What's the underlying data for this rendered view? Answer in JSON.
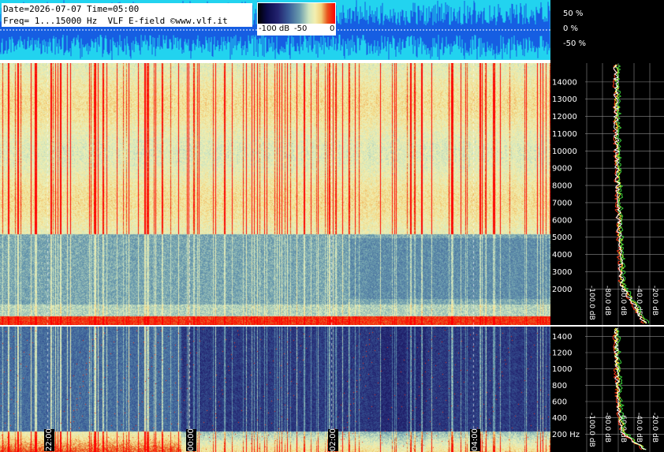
{
  "header": {
    "line1": "Date=2026-07-07 Time=05:00",
    "line2": "Freq= 1...15000 Hz  VLF E-field ©www.vlf.it"
  },
  "colorbar": {
    "labels": [
      "-100 dB",
      "-50",
      "0"
    ],
    "colors": [
      "#000000",
      "#23236f",
      "#3a5d98",
      "#6a9cae",
      "#f3efb0",
      "#e8541c",
      "#ff0000"
    ]
  },
  "waveform": {
    "labels": [
      "50 %",
      "0 %",
      "-50 %"
    ],
    "background": "#22d3ef",
    "trace_color": "#1010d8"
  },
  "chart_data": [
    {
      "type": "heatmap",
      "title": "",
      "panel": "spectrogram-upper",
      "ylim": [
        0,
        15000
      ],
      "yticks": [
        2000,
        3000,
        4000,
        5000,
        6000,
        7000,
        8000,
        9000,
        10000,
        11000,
        12000,
        13000,
        14000
      ],
      "ytick_labels": [
        "2000",
        "3000",
        "4000",
        "5000",
        "6000",
        "7000",
        "8000",
        "9000",
        "10000",
        "11000",
        "12000",
        "13000",
        "14000"
      ],
      "side_spectrum_xlabels": [
        "-100.0 dB",
        "-80.0 dB",
        "-60.0 dB",
        "-40.0 dB",
        "-20.0 dB"
      ]
    },
    {
      "type": "heatmap",
      "title": "",
      "panel": "spectrogram-lower",
      "ylim": [
        0,
        1500
      ],
      "yticks": [
        200,
        400,
        600,
        800,
        1000,
        1200,
        1400
      ],
      "ytick_labels": [
        "200 Hz",
        "400",
        "600",
        "800",
        "1000",
        "1200",
        "1400"
      ],
      "side_spectrum_xlabels": [
        "-100.0 dB",
        "-80.0 dB",
        "-60.0 dB",
        "-40.0 dB",
        "-20.0 dB"
      ]
    }
  ],
  "time_markers": [
    "22:00",
    "00:00",
    "02:00",
    "04:00"
  ]
}
